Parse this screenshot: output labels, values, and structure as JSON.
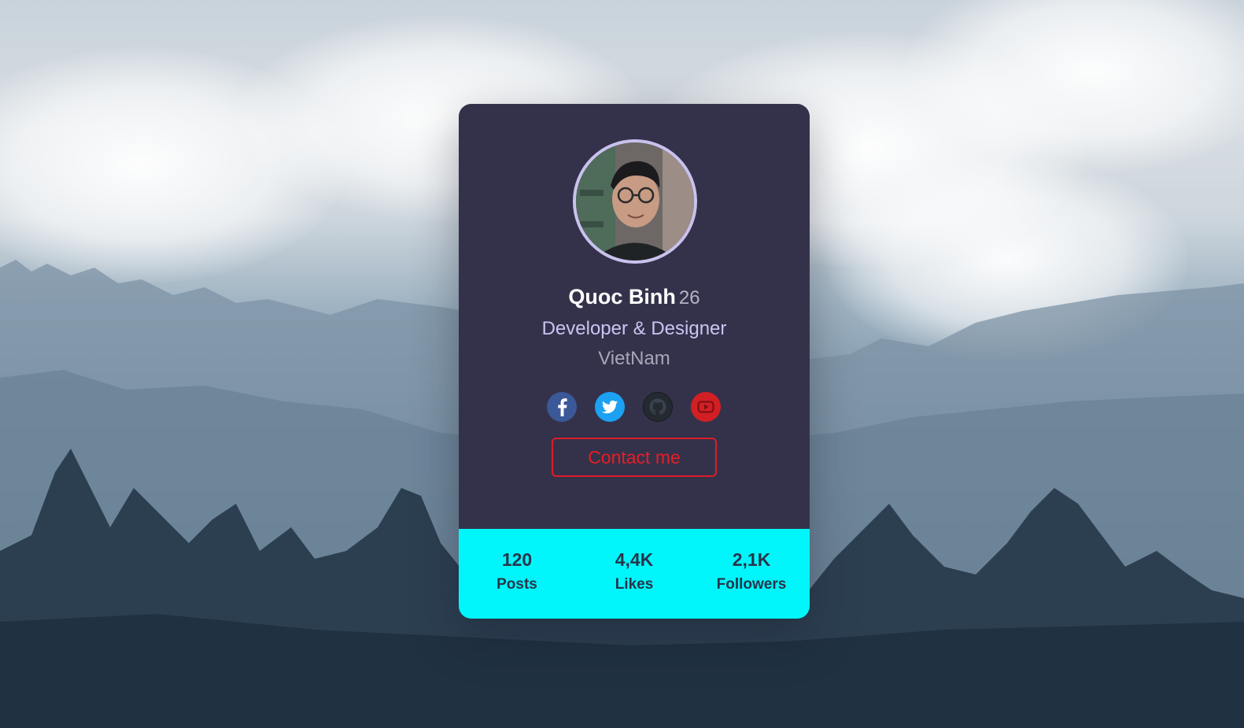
{
  "profile": {
    "name": "Quoc Binh",
    "age": "26",
    "role": "Developer & Designer",
    "location": "VietNam"
  },
  "socials": [
    {
      "icon": "facebook-icon",
      "color": "#3b5998"
    },
    {
      "icon": "twitter-icon",
      "color": "#1da1f2"
    },
    {
      "icon": "github-icon",
      "color": "#242a30"
    },
    {
      "icon": "youtube-icon",
      "color": "#d21f24"
    }
  ],
  "contact": {
    "label": "Contact me",
    "color": "#e81d25"
  },
  "stats": [
    {
      "value": "120",
      "label": "Posts"
    },
    {
      "value": "4,4K",
      "label": "Likes"
    },
    {
      "value": "2,1K",
      "label": "Followers"
    }
  ],
  "colors": {
    "card_background": "#34324a",
    "avatar_ring": "#c9c2ee",
    "stats_background": "#00f6fa",
    "stats_text": "#27344a"
  }
}
